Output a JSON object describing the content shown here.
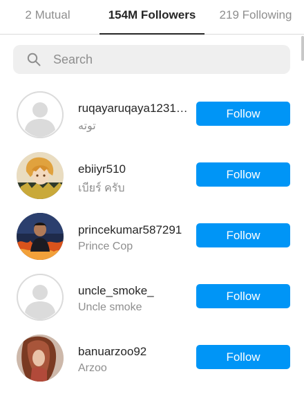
{
  "tabs": [
    {
      "label": "2 Mutual"
    },
    {
      "label": "154M Followers",
      "active": true
    },
    {
      "label": "219 Following"
    }
  ],
  "search": {
    "placeholder": "Search",
    "value": ""
  },
  "follow_button_color": "#0095f6",
  "followers": [
    {
      "username": "ruqayaruqaya1231…",
      "full_name": "توته",
      "button": "Follow",
      "avatar": "default-avatar"
    },
    {
      "username": "ebiiyr510",
      "full_name": "เบียร์ ครับ",
      "button": "Follow",
      "avatar": "anime-character-photo"
    },
    {
      "username": "princekumar587291",
      "full_name": "Prince Cop",
      "button": "Follow",
      "avatar": "man-with-fire-photo"
    },
    {
      "username": "uncle_smoke_",
      "full_name": "Uncle smoke",
      "button": "Follow",
      "avatar": "default-avatar"
    },
    {
      "username": "banuarzoo92",
      "full_name": "Arzoo",
      "button": "Follow",
      "avatar": "woman-with-hair-photo"
    }
  ]
}
